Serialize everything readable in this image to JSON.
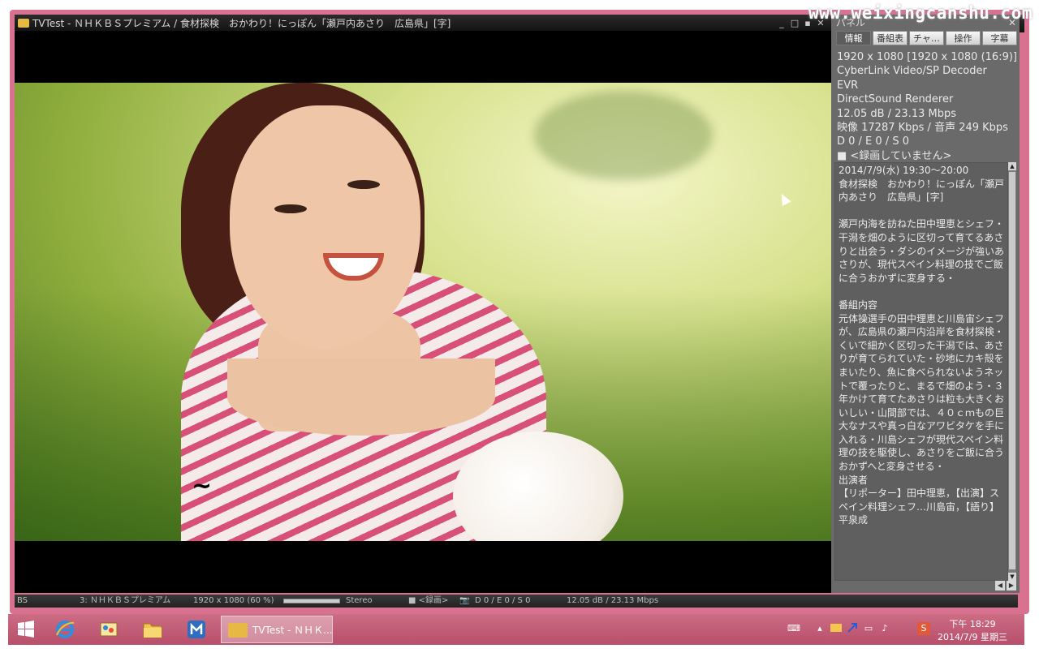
{
  "watermark": "www.weixingcanshu.com",
  "window": {
    "title": "TVTest - ＮＨＫＢＳプレミアム / 食材探検　おかわり！にっぽん「瀬戸内あさり　広島県」[字]",
    "buttons": [
      "_",
      "□",
      "▪",
      "✕"
    ]
  },
  "panel": {
    "title": "パネル",
    "close": "✕",
    "tabs": [
      "情報",
      "番組表",
      "チャ…",
      "操作",
      "字幕"
    ],
    "stats": [
      "1920 x 1080 [1920 x 1080 (16:9)]",
      "CyberLink Video/SP Decoder",
      "EVR",
      "DirectSound Renderer",
      "12.05 dB / 23.13 Mbps",
      "映像 17287 Kbps / 音声 249 Kbps",
      "D 0 / E 0 / S 0",
      "■ <録画していません>"
    ],
    "description": "2014/7/9(水) 19:30～20:00\n食材探検　おかわり！にっぽん「瀬戸内あさり　広島県」[字]\n\n瀬戸内海を訪ねた田中理恵とシェフ・干潟を畑のように区切って育てるあさりと出会う・ダシのイメージが強いあさりが、現代スペイン料理の技でご飯に合うおかずに変身する・\n\n番組内容\n元体操選手の田中理恵と川島宙シェフが、広島県の瀬戸内沿岸を食材探検・くいで細かく区切った干潟では、あさりが育てられていた・砂地にカキ殻をまいたり、魚に食べられないようネットで覆ったりと、まるで畑のよう・３年かけて育てたあさりは粒も大きくおいしい・山間部では、４０ｃｍもの巨大なナスや真っ白なアワビタケを手に入れる・川島シェフが現代スペイン料理の技を駆使し、あさりをご飯に合うおかずへと変身させる・\n出演者\n【リポーター】田中理恵，【出演】スペイン料理シェフ…川島宙，【語り】平泉成"
  },
  "video": {
    "tilde": "~"
  },
  "statusbar": {
    "source": "BS",
    "channel": "3: ＮＨＫＢＳプレミアム",
    "resolution": "1920 x 1080 (60 %)",
    "volume_level": 1.0,
    "audio": "Stereo",
    "record": "■ <録画>",
    "capture_icon": "📷",
    "errors": "D 0 / E 0 / S 0",
    "signal": "12.05 dB / 23.13 Mbps"
  },
  "taskbar": {
    "task_label": "TVTest - ＮＨＫ...",
    "icons": [
      "windows-start-icon",
      "internet-explorer-icon",
      "paint-icon",
      "file-explorer-icon",
      "maxthon-icon"
    ],
    "clock_time": "下午 18:29",
    "clock_date": "2014/7/9 星期三",
    "tray_icons": [
      "keyboard-icon",
      "chevron-up-icon",
      "folder-icon",
      "arrow-icon",
      "network-icon",
      "volume-icon",
      "sogou-icon"
    ]
  }
}
